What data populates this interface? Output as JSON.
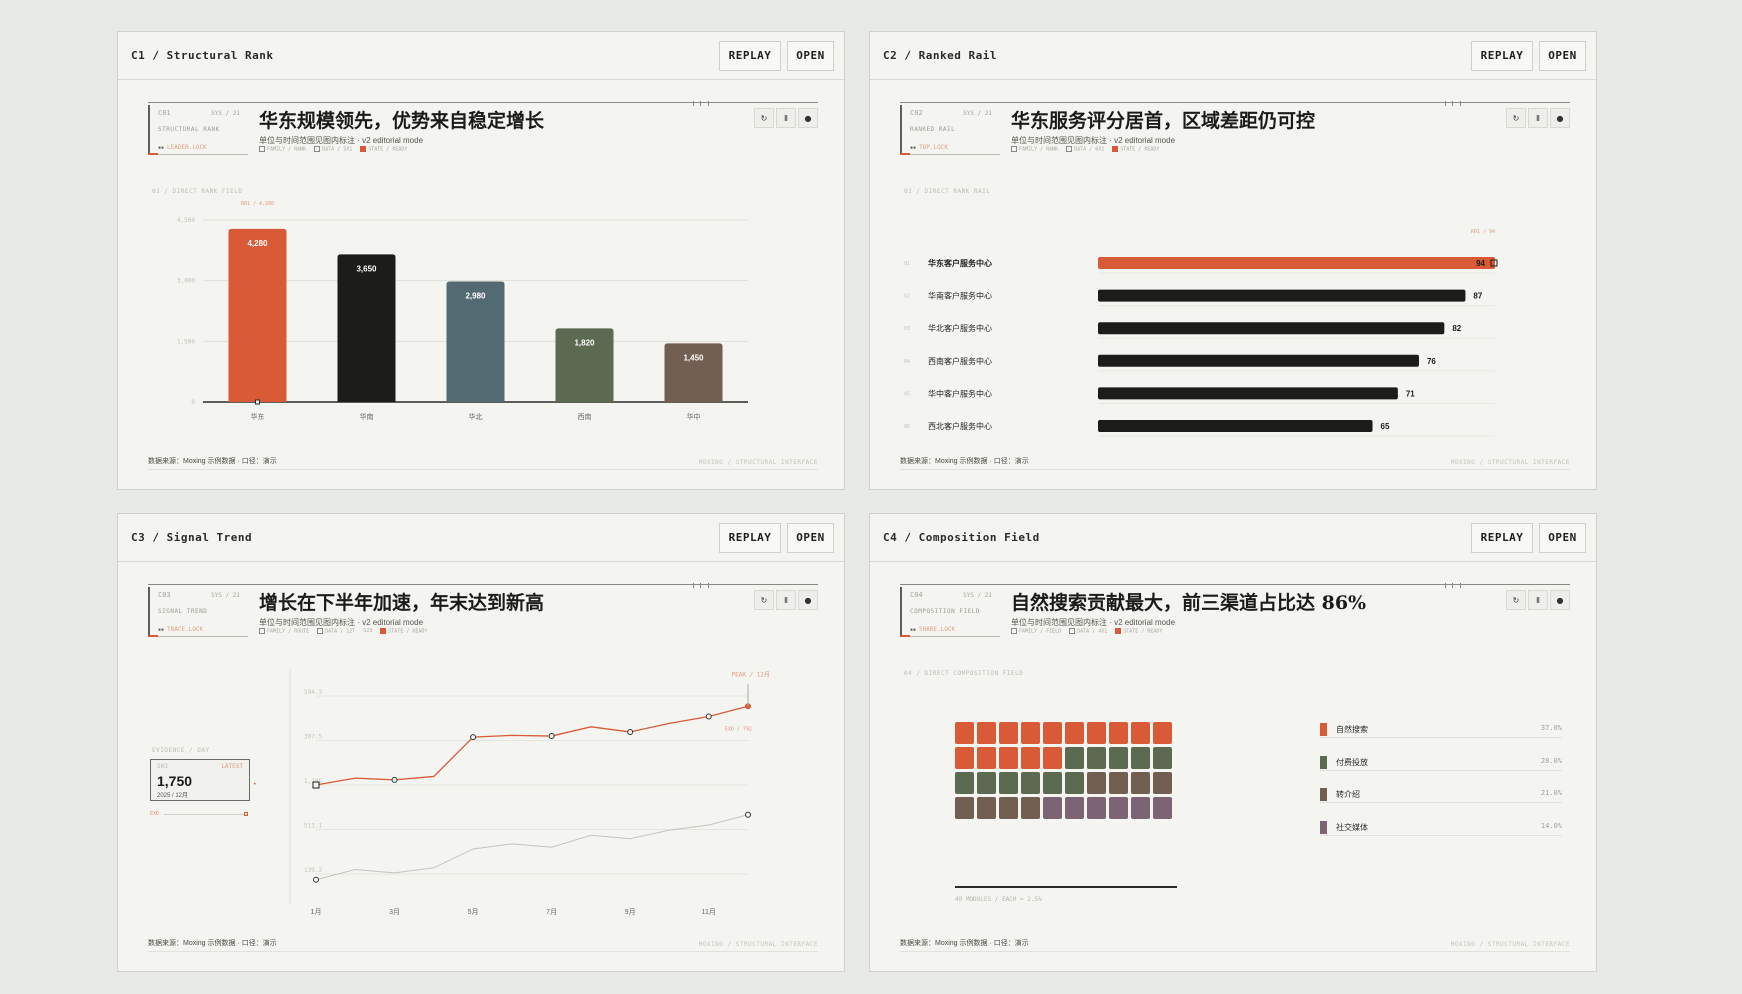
{
  "cards": [
    {
      "title": "C1 / Structural Rank",
      "replay": "REPLAY",
      "open": "OPEN",
      "meta": {
        "id": "C01",
        "sys": "SYS / 21",
        "name": "STRUCTURAL RANK",
        "lock": "LEADER.LOCK"
      },
      "headline": "华东规模领先，优势来自稳定增长",
      "subtitle": "单位与时间范围见图内标注 · v2 editorial mode",
      "chips": [
        "FAMILY / RANK",
        "DATA / 5X1",
        "STATE / READY"
      ],
      "section": "01 / DIRECT RANK FIELD",
      "footer_left": "数据来源：Moxing 示例数据 · 口径：演示",
      "footer_right": "MOXING / STRUCTURAL INTERFACE"
    },
    {
      "title": "C2 / Ranked Rail",
      "replay": "REPLAY",
      "open": "OPEN",
      "meta": {
        "id": "C02",
        "sys": "SYS / 21",
        "name": "RANKED RAIL",
        "lock": "TOP.LOCK"
      },
      "headline": "华东服务评分居首，区域差距仍可控",
      "subtitle": "单位与时间范围见图内标注 · v2 editorial mode",
      "chips": [
        "FAMILY / RANK",
        "DATA / 6X1",
        "STATE / READY"
      ],
      "section": "02 / DIRECT RANK RAIL",
      "footer_left": "数据来源：Moxing 示例数据 · 口径：演示",
      "footer_right": "MOXING / STRUCTURAL INTERFACE"
    },
    {
      "title": "C3 / Signal Trend",
      "replay": "REPLAY",
      "open": "OPEN",
      "meta": {
        "id": "C03",
        "sys": "SYS / 21",
        "name": "SIGNAL TREND",
        "lock": "TRACE.LOCK"
      },
      "headline": "增长在下半年加速，年末达到新高",
      "subtitle": "单位与时间范围见图内标注 · v2 editorial mode",
      "chips": [
        "FAMILY / ROUTE",
        "DATA / 12T",
        "S23",
        "STATE / READY"
      ],
      "section": "",
      "footer_left": "数据来源：Moxing 示例数据 · 口径：演示",
      "footer_right": "MOXING / STRUCTURAL INTERFACE",
      "evidence": {
        "label": "EVIDENCE / DAY",
        "tag": "S03",
        "badge": "LATEST",
        "value": "1,750",
        "date": "2025 / 12月",
        "rule": "EXD"
      }
    },
    {
      "title": "C4 / Composition Field",
      "replay": "REPLAY",
      "open": "OPEN",
      "meta": {
        "id": "C04",
        "sys": "SYS / 21",
        "name": "COMPOSITION FIELD",
        "lock": "SHARE.LOCK"
      },
      "headline": "自然搜索贡献最大，前三渠道占比达 86%",
      "subtitle": "单位与时间范围见图内标注 · v2 editorial mode",
      "chips": [
        "FAMILY / FIELD",
        "DATA / 4X1",
        "STATE / READY"
      ],
      "section": "04 / DIRECT COMPOSITION FIELD",
      "footer_left": "数据来源：Moxing 示例数据 · 口径：演示",
      "footer_right": "MOXING / STRUCTURAL INTERFACE",
      "waffle_note": "40 MODULES / EACH = 2.5%"
    }
  ],
  "colors": {
    "accent": "#d95a36",
    "dark": "#1c1c1a",
    "slate": "#546a72",
    "olive": "#5c6a52",
    "brown": "#735e52",
    "mauve": "#7d6474",
    "grey_line": "#c4c4be"
  },
  "chart_data": [
    {
      "type": "bar",
      "categories": [
        "华东",
        "华南",
        "华北",
        "西南",
        "华中"
      ],
      "values": [
        4280,
        3650,
        2980,
        1820,
        1450
      ],
      "value_labels": [
        "4,280",
        "3,650",
        "2,980",
        "1,820",
        "1,450"
      ],
      "yticks": [
        "0",
        "1,500",
        "3,000",
        "4,500"
      ],
      "ylim": [
        0,
        4500
      ],
      "annotation": "R01 / 4,280",
      "colors": [
        "#d95a36",
        "#1c1c1a",
        "#546a72",
        "#5c6a52",
        "#735e52"
      ]
    },
    {
      "type": "bar",
      "orientation": "horizontal",
      "categories": [
        "华东客户服务中心",
        "华南客户服务中心",
        "华北客户服务中心",
        "西南客户服务中心",
        "华中客户服务中心",
        "西北客户服务中心"
      ],
      "ranks": [
        "01",
        "02",
        "03",
        "04",
        "05",
        "06"
      ],
      "values": [
        94,
        87,
        82,
        76,
        71,
        65
      ],
      "xlim": [
        0,
        94
      ],
      "annotation": "R01 / 94"
    },
    {
      "type": "line",
      "x": [
        "1月",
        "2月",
        "3月",
        "4月",
        "5月",
        "6月",
        "7月",
        "8月",
        "9月",
        "10月",
        "11月",
        "12月"
      ],
      "xticks": [
        "1月",
        "3月",
        "5月",
        "7月",
        "9月",
        "11月"
      ],
      "yticks": [
        "139.2",
        "513.1",
        "1,185",
        "307.5",
        "594.3"
      ],
      "series": [
        {
          "values": [
            560,
            580,
            575,
            585,
            700,
            705,
            703,
            730,
            715,
            740,
            760,
            790
          ]
        },
        {
          "values": [
            400,
            430,
            420,
            435,
            490,
            505,
            495,
            530,
            520,
            545,
            560,
            590
          ]
        }
      ],
      "ylim": [
        300,
        820
      ],
      "peak_label": "PEAK / 12月",
      "ref_label": "EXD / 792"
    },
    {
      "type": "waffle",
      "categories": [
        "自然搜索",
        "付费投放",
        "转介绍",
        "社交媒体"
      ],
      "values": [
        37.0,
        28.0,
        21.0,
        14.0
      ],
      "value_labels": [
        "37.0%",
        "28.0%",
        "21.0%",
        "14.0%"
      ],
      "cells": [
        15,
        11,
        8,
        6
      ],
      "colors": [
        "#d95a36",
        "#5c6a52",
        "#735e52",
        "#7d6474"
      ]
    }
  ]
}
